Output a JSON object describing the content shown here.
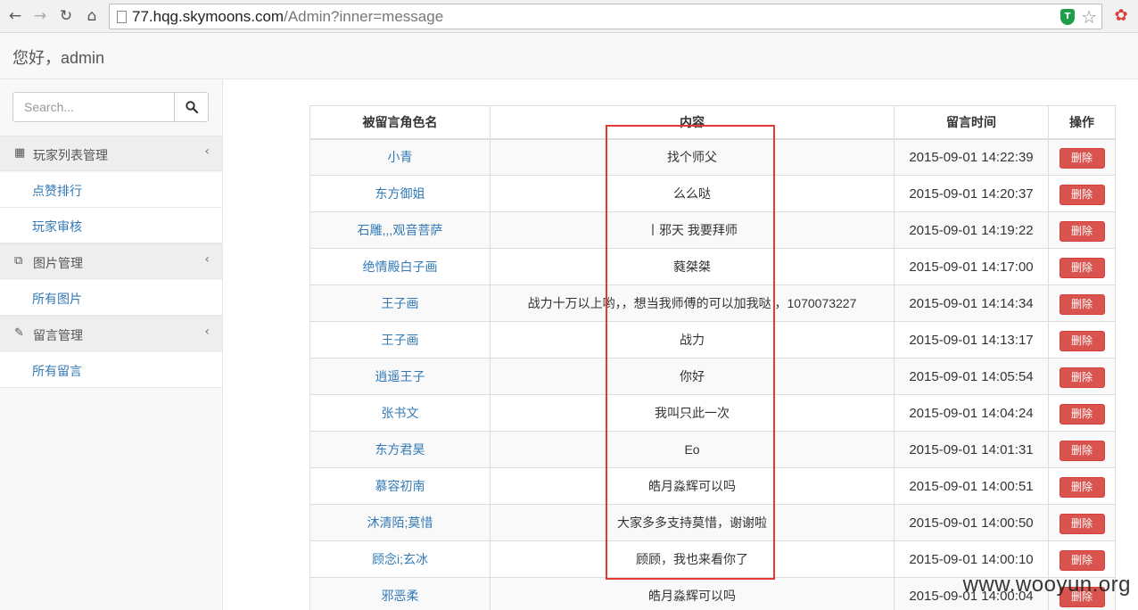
{
  "browser": {
    "url_host": "77.hqg.skymoons.com",
    "url_path": "/Admin?inner=message"
  },
  "header": {
    "greeting": "您好，admin"
  },
  "sidebar": {
    "search_placeholder": "Search...",
    "groups": [
      {
        "label": "玩家列表管理",
        "icon": "table-icon",
        "items": [
          "点赞排行",
          "玩家审核"
        ]
      },
      {
        "label": "图片管理",
        "icon": "copy-icon",
        "items": [
          "所有图片"
        ]
      },
      {
        "label": "留言管理",
        "icon": "edit-icon",
        "items": [
          "所有留言"
        ]
      }
    ]
  },
  "table": {
    "headers": [
      "被留言角色名",
      "内容",
      "留言时间",
      "操作"
    ],
    "delete_label": "删除",
    "rows": [
      {
        "name": "小青",
        "content": "找个师父",
        "time": "2015-09-01 14:22:39"
      },
      {
        "name": "东方御姐",
        "content": "么么哒",
        "time": "2015-09-01 14:20:37"
      },
      {
        "name": "石雕,,,观音菩萨",
        "content": "丨邪天 我要拜师",
        "time": "2015-09-01 14:19:22"
      },
      {
        "name": "绝情殿白子画",
        "content": "蕤桀桀",
        "time": "2015-09-01 14:17:00"
      },
      {
        "name": "王子画",
        "content": "战力十万以上哟，，想当我师傅的可以加我哒 ，1070073227",
        "time": "2015-09-01 14:14:34"
      },
      {
        "name": "王子画",
        "content": "战力",
        "time": "2015-09-01 14:13:17"
      },
      {
        "name": "逍遥王子",
        "content": "你好",
        "time": "2015-09-01 14:05:54"
      },
      {
        "name": "张书文",
        "content": "我叫只此一次",
        "time": "2015-09-01 14:04:24"
      },
      {
        "name": "东方君昊",
        "content": "Eo",
        "time": "2015-09-01 14:01:31"
      },
      {
        "name": "慕容初南",
        "content": "皓月淼辉可以吗",
        "time": "2015-09-01 14:00:51"
      },
      {
        "name": "沐清陌;莫惜",
        "content": "大家多多支持莫惜，谢谢啦",
        "time": "2015-09-01 14:00:50"
      },
      {
        "name": "顾念i;玄冰",
        "content": "顾顾，我也来看你了",
        "time": "2015-09-01 14:00:10"
      },
      {
        "name": "邪恶柔",
        "content": "皓月淼辉可以吗",
        "time": "2015-09-01 14:00:04"
      }
    ]
  },
  "watermark": "www.wooyun.org",
  "colors": {
    "link": "#337ab7",
    "danger": "#d9534f",
    "highlight": "#e53935"
  }
}
